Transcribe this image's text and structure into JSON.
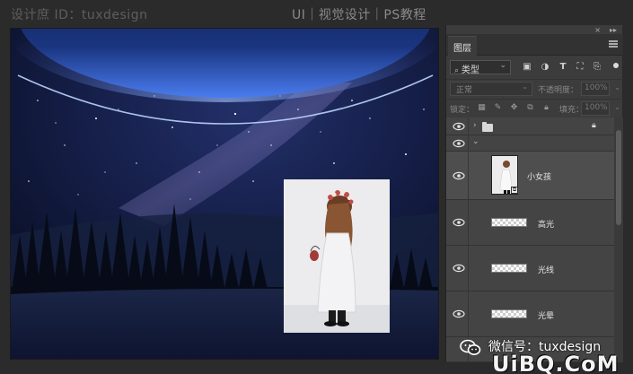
{
  "watermark_top_left": "设计庶 ID：tuxdesign",
  "watermark_top_right": "UI｜视觉设计｜PS教程",
  "panel": {
    "tab_label": "图层",
    "filter_kind": "类型",
    "filter_icons": [
      "image-filter-icon",
      "adjustment-filter-icon",
      "text-filter-icon",
      "shape-filter-icon",
      "smartobject-filter-icon"
    ],
    "blend_mode": "正常",
    "opacity_label": "不透明度：",
    "opacity_value": "100%",
    "lock_label": "锁定：",
    "fill_label": "填充：",
    "fill_value": "100%"
  },
  "layers": [
    {
      "type": "group",
      "name": "",
      "collapsed": true,
      "locked": true
    },
    {
      "type": "group",
      "name": "",
      "collapsed": false,
      "locked": false
    },
    {
      "type": "smart",
      "name": "小女孩",
      "selected": true
    },
    {
      "type": "pixel",
      "name": "高光"
    },
    {
      "type": "pixel",
      "name": "光线"
    },
    {
      "type": "pixel",
      "name": "光晕"
    }
  ],
  "footer": {
    "wechat_label": "微信号：tuxdesign",
    "site_logo": "UiBQ.CoM"
  }
}
